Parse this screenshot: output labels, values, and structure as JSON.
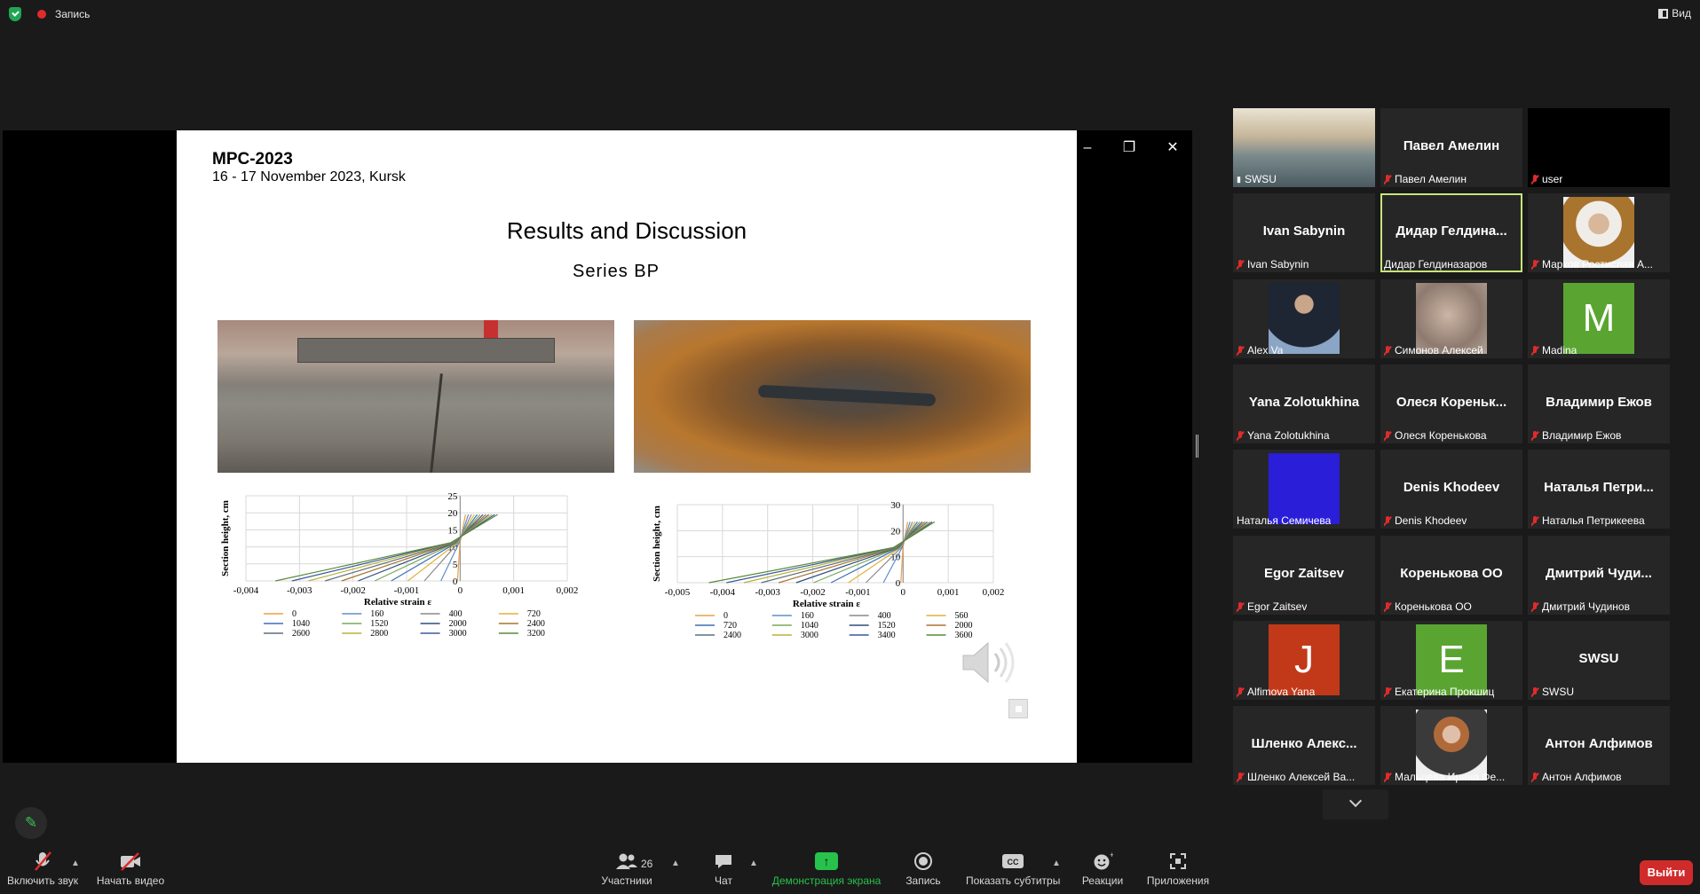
{
  "topbar": {
    "recording_label": "Запись",
    "view_label": "Вид"
  },
  "slide": {
    "conference": "MPC-2023",
    "date_place": "16 - 17 November 2023, Kursk",
    "title": "Results and Discussion",
    "subtitle": "Series BP"
  },
  "chart_data": [
    {
      "type": "line",
      "xlabel": "Relative strain ε",
      "ylabel": "Section height, cm",
      "x_ticks": [
        "-0,004",
        "-0,003",
        "-0,002",
        "-0,001",
        "0",
        "0,001",
        "0,002"
      ],
      "y_ticks": [
        "0",
        "5",
        "10",
        "15",
        "20",
        "25"
      ],
      "xlim": [
        -0.004,
        0.002
      ],
      "ylim": [
        0,
        25
      ],
      "grid": true,
      "legend_position": "bottom",
      "series": [
        {
          "name": "0"
        },
        {
          "name": "160"
        },
        {
          "name": "400"
        },
        {
          "name": "720"
        },
        {
          "name": "1040"
        },
        {
          "name": "1520"
        },
        {
          "name": "2000"
        },
        {
          "name": "2400"
        },
        {
          "name": "2600"
        },
        {
          "name": "2800"
        },
        {
          "name": "3000"
        },
        {
          "name": "3200"
        }
      ]
    },
    {
      "type": "line",
      "xlabel": "Relative strain ε",
      "ylabel": "Section height, cm",
      "x_ticks": [
        "-0,005",
        "-0,004",
        "-0,003",
        "-0,002",
        "-0,001",
        "0",
        "0,001",
        "0,002"
      ],
      "y_ticks": [
        "0",
        "10",
        "20",
        "30"
      ],
      "xlim": [
        -0.005,
        0.002
      ],
      "ylim": [
        0,
        30
      ],
      "grid": true,
      "legend_position": "bottom",
      "series": [
        {
          "name": "0"
        },
        {
          "name": "160"
        },
        {
          "name": "400"
        },
        {
          "name": "560"
        },
        {
          "name": "720"
        },
        {
          "name": "1040"
        },
        {
          "name": "1520"
        },
        {
          "name": "2000"
        },
        {
          "name": "2400"
        },
        {
          "name": "3000"
        },
        {
          "name": "3400"
        },
        {
          "name": "3600"
        }
      ]
    }
  ],
  "participants": [
    {
      "display": "",
      "label": "SWSU",
      "muted": false,
      "pinned": true
    },
    {
      "display": "Павел Амелин",
      "label": "Павел Амелин",
      "muted": true
    },
    {
      "display": "",
      "label": "user",
      "muted": true
    },
    {
      "display": "Ivan Sabynin",
      "label": "Ivan Sabynin",
      "muted": true
    },
    {
      "display": "Дидар Гелдина...",
      "label": "Дидар Гелдиназаров",
      "muted": false,
      "active": true
    },
    {
      "display": "",
      "label": "Марков Ростислав А...",
      "muted": true
    },
    {
      "display": "",
      "label": "Alex Va",
      "muted": true
    },
    {
      "display": "",
      "label": "Симонов Алексей",
      "muted": true
    },
    {
      "display": "M",
      "label": "Madina",
      "muted": true
    },
    {
      "display": "Yana Zolotukhina",
      "label": "Yana Zolotukhina",
      "muted": true
    },
    {
      "display": "Олеся Кореньк...",
      "label": "Олеся Коренькова",
      "muted": true
    },
    {
      "display": "Владимир Ежов",
      "label": "Владимир Ежов",
      "muted": true
    },
    {
      "display": "",
      "label": "Наталья Семичева",
      "muted": false
    },
    {
      "display": "Denis Khodeev",
      "label": "Denis Khodeev",
      "muted": true
    },
    {
      "display": "Наталья Петри...",
      "label": "Наталья Петрикеева",
      "muted": true
    },
    {
      "display": "Egor Zaitsev",
      "label": "Egor Zaitsev",
      "muted": true
    },
    {
      "display": "Коренькова ОО",
      "label": "Коренькова ОО",
      "muted": true
    },
    {
      "display": "Дмитрий Чуди...",
      "label": "Дмитрий Чудинов",
      "muted": true
    },
    {
      "display": "J",
      "label": "Alfimova Yana",
      "muted": true
    },
    {
      "display": "E",
      "label": "Екатерина Прокшиц",
      "muted": true
    },
    {
      "display": "SWSU",
      "label": "SWSU",
      "muted": true
    },
    {
      "display": "Шленко Алекс...",
      "label": "Шленко Алексей Ва...",
      "muted": true
    },
    {
      "display": "",
      "label": "Мальцева Ирина Фе...",
      "muted": true
    },
    {
      "display": "Антон Алфимов",
      "label": "Антон Алфимов",
      "muted": true
    }
  ],
  "colors": {
    "active_speaker": "#c7e57a",
    "share_green": "#27c24c",
    "exit_red": "#d02b2b",
    "madina_avatar": "#5aa532",
    "yana_avatar": "#c2391a",
    "ekaterina_avatar": "#5aa532",
    "natalia_avatar": "#2a1ed8"
  },
  "toolbar": {
    "audio": "Включить звук",
    "video": "Начать видео",
    "participants": "Участники",
    "participants_count": "26",
    "chat": "Чат",
    "share": "Демонстрация экрана",
    "record": "Запись",
    "captions": "Показать субтитры",
    "reactions": "Реакции",
    "apps": "Приложения",
    "exit": "Выйти"
  }
}
